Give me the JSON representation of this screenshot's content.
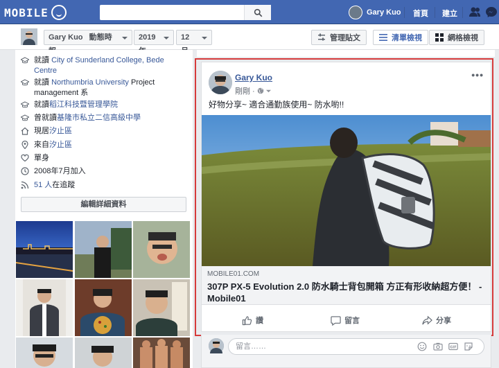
{
  "topbar": {
    "logo_text": "MOBILE",
    "search_placeholder": "",
    "user_name": "Gary Kuo",
    "home_label": "首頁",
    "create_label": "建立"
  },
  "toolbar": {
    "profile_name": "Gary Kuo",
    "activity_label": "動態時報",
    "year": "2019年",
    "month": "12 月",
    "manage_posts": "管理貼文",
    "list_view": "清單檢視",
    "grid_view": "網格檢視"
  },
  "intro": {
    "items": [
      {
        "icon": "education-icon",
        "prefix": "就讀 ",
        "link": "City of Sunderland College, Bede Centre",
        "suffix": ""
      },
      {
        "icon": "education-icon",
        "prefix": "就讀 ",
        "link": "Northumbria University",
        "suffix": " Project management 系"
      },
      {
        "icon": "education-icon",
        "prefix": "就讀",
        "link": "稻江科技暨管理學院",
        "suffix": ""
      },
      {
        "icon": "education-icon",
        "prefix": "曾就讀",
        "link": "基隆市私立二信高級中學",
        "suffix": ""
      },
      {
        "icon": "home-icon",
        "prefix": "現居",
        "link": "汐止區",
        "suffix": ""
      },
      {
        "icon": "location-icon",
        "prefix": "來自",
        "link": "汐止區",
        "suffix": ""
      },
      {
        "icon": "heart-icon",
        "prefix": "單身",
        "link": "",
        "suffix": ""
      },
      {
        "icon": "clock-icon",
        "prefix": "2008年7月加入",
        "link": "",
        "suffix": ""
      },
      {
        "icon": "rss-icon",
        "prefix": "",
        "link": "51 人",
        "suffix": "在追蹤"
      }
    ],
    "edit_details": "編輯詳細資料"
  },
  "post": {
    "author": "Gary Kuo",
    "time": "剛剛 · ",
    "text": "好物分享~ 適合通勤族使用~ 防水喲!!",
    "link_domain": "MOBILE01.COM",
    "link_title": "307P PX-5 Evolution 2.0 防水騎士背包開箱 方正有形收納超方便！ - Mobile01",
    "like": "讚",
    "comment": "留言",
    "share": "分享"
  },
  "comment_box": {
    "placeholder": "留言……"
  },
  "colors": {
    "brand": "#4267b2",
    "link": "#385898",
    "highlight": "#d63a3a"
  }
}
